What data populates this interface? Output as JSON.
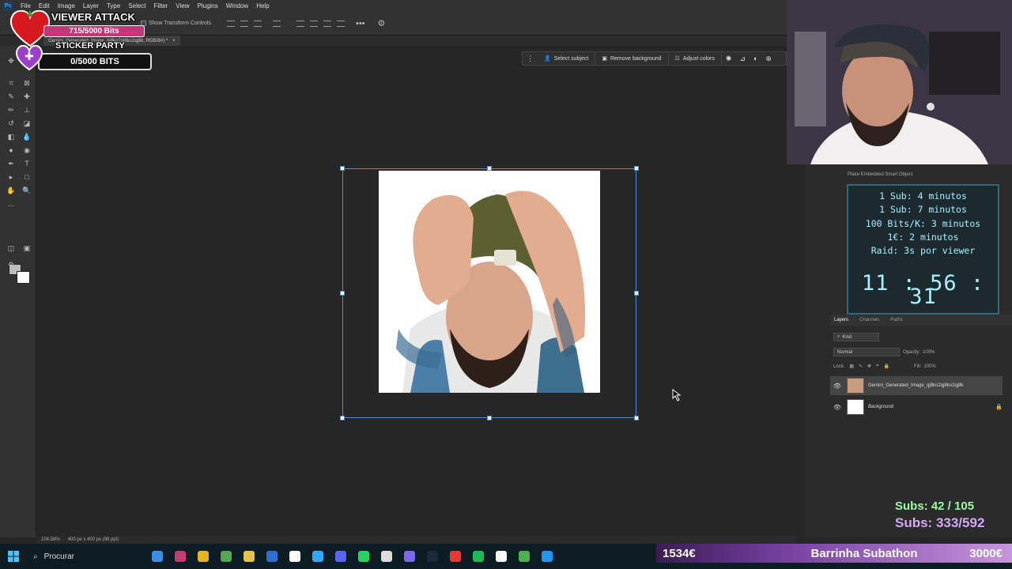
{
  "menubar": {
    "logo": "Ps",
    "items": [
      "File",
      "Edit",
      "Image",
      "Layer",
      "Type",
      "Select",
      "Filter",
      "View",
      "Plugins",
      "Window",
      "Help"
    ]
  },
  "options_bar": {
    "transform_controls_label": "Show Transform Controls"
  },
  "document": {
    "tab_label": "Gemini_Generated_Image_qj8ko2qj8ko2qj8k, RGB/8#) *",
    "zoom": "104.58%",
    "dimensions": "400 px x 400 px (96 ppi)"
  },
  "contextual_taskbar": {
    "select_subject": "Select subject",
    "remove_background": "Remove background",
    "adjust_colors": "Adjust colors"
  },
  "history": {
    "item": "Place Embedded Smart Object"
  },
  "layers_panel": {
    "tabs": [
      "Layers",
      "Channels",
      "Paths"
    ],
    "filter_kind": "Kind",
    "blend_mode": "Normal",
    "opacity_label": "Opacity:",
    "opacity_value": "100%",
    "lock_label": "Lock:",
    "fill_label": "Fill:",
    "fill_value": "100%",
    "layers": [
      {
        "name": "Gemini_Generated_Image_qj8ko2qj8ko2qj8k"
      },
      {
        "name": "Background"
      }
    ]
  },
  "overlay": {
    "viewer_attack_title": "VIEWER ATTACK",
    "viewer_attack_bits": "715/5000 Bits",
    "sticker_party_title": "STICKER PARTY",
    "sticker_party_bits": "0/5000 BITS"
  },
  "timer": {
    "lines": [
      "1 Sub: 4 minutos",
      "1 Sub: 7 minutos",
      "100 Bits/K: 3 minutos",
      "1€: 2 minutos",
      "Raid: 3s por viewer"
    ],
    "clock": "11 : 56 : 31"
  },
  "subs": {
    "line1": "Subs: 42 / 105",
    "line2": "Subs: 333/592"
  },
  "subathon": {
    "left_value": "1534€",
    "title": "Barrinha Subathon",
    "right_value": "3000€"
  },
  "win_taskbar": {
    "search_placeholder": "Procurar",
    "app_colors": [
      "#3b8fe0",
      "#c43b6f",
      "#e6b422",
      "#53a653",
      "#e8c14a",
      "#2e6fd3",
      "#ffffff",
      "#31a8ff",
      "#5865f2",
      "#25d366",
      "#dddddd",
      "#7b68ee",
      "#1b2838",
      "#e53935",
      "#1db954",
      "#ffffff",
      "#4caf50",
      "#2196f3"
    ]
  }
}
